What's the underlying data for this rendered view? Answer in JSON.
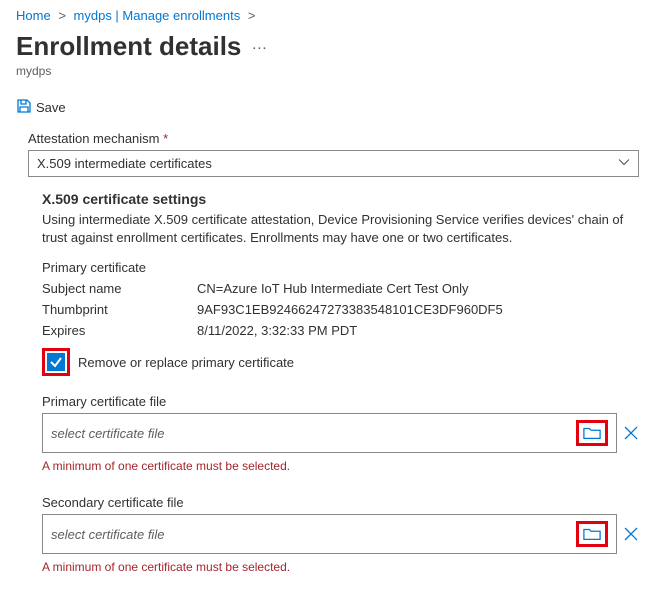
{
  "breadcrumb": {
    "home": "Home",
    "parent": "mydps | Manage enrollments"
  },
  "title": "Enrollment details",
  "subtitle": "mydps",
  "toolbar": {
    "save": "Save"
  },
  "attestation": {
    "label": "Attestation mechanism",
    "value": "X.509 intermediate certificates"
  },
  "x509": {
    "heading": "X.509 certificate settings",
    "desc": "Using intermediate X.509 certificate attestation, Device Provisioning Service verifies devices' chain of trust against enrollment certificates. Enrollments may have one or two certificates.",
    "primary_label": "Primary certificate",
    "subject_name_k": "Subject name",
    "subject_name_v": "CN=Azure IoT Hub Intermediate Cert Test Only",
    "thumbprint_k": "Thumbprint",
    "thumbprint_v": "9AF93C1EB92466247273383548101CE3DF960DF5",
    "expires_k": "Expires",
    "expires_v": "8/11/2022, 3:32:33 PM PDT",
    "remove_replace": "Remove or replace primary certificate",
    "primary_file_label": "Primary certificate file",
    "secondary_file_label": "Secondary certificate file",
    "placeholder": "select certificate file",
    "error": "A minimum of one certificate must be selected."
  }
}
